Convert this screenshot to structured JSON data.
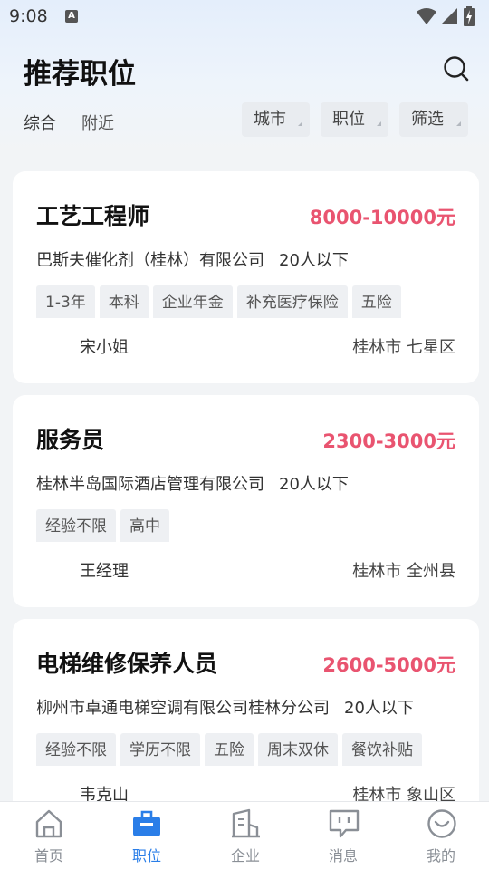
{
  "status_bar": {
    "time": "9:08",
    "notification_glyph": "A"
  },
  "header": {
    "title": "推荐职位",
    "tabs": [
      "综合",
      "附近"
    ],
    "filters": [
      "城市",
      "职位",
      "筛选"
    ]
  },
  "jobs": [
    {
      "title": "工艺工程师",
      "salary": "8000-10000元",
      "company": "巴斯夫催化剂（桂林）有限公司",
      "size": "20人以下",
      "tags": [
        "1-3年",
        "本科",
        "企业年金",
        "补充医疗保险",
        "五险"
      ],
      "contact": "宋小姐",
      "location": "桂林市 七星区"
    },
    {
      "title": "服务员",
      "salary": "2300-3000元",
      "company": "桂林半岛国际酒店管理有限公司",
      "size": "20人以下",
      "tags": [
        "经验不限",
        "高中"
      ],
      "contact": "王经理",
      "location": "桂林市 全州县"
    },
    {
      "title": "电梯维修保养人员",
      "salary": "2600-5000元",
      "company": "柳州市卓通电梯空调有限公司桂林分公司",
      "size": "20人以下",
      "tags": [
        "经验不限",
        "学历不限",
        "五险",
        "周末双休",
        "餐饮补贴"
      ],
      "contact": "韦克山",
      "location": "桂林市 象山区"
    }
  ],
  "bottom_nav": {
    "items": [
      {
        "label": "首页",
        "icon": "home-icon"
      },
      {
        "label": "职位",
        "icon": "briefcase-icon"
      },
      {
        "label": "企业",
        "icon": "building-icon"
      },
      {
        "label": "消息",
        "icon": "message-icon"
      },
      {
        "label": "我的",
        "icon": "profile-icon"
      }
    ],
    "active_index": 1
  },
  "colors": {
    "accent": "#2a7ee8",
    "salary": "#e95470",
    "page_background": "#f2f4f6"
  }
}
